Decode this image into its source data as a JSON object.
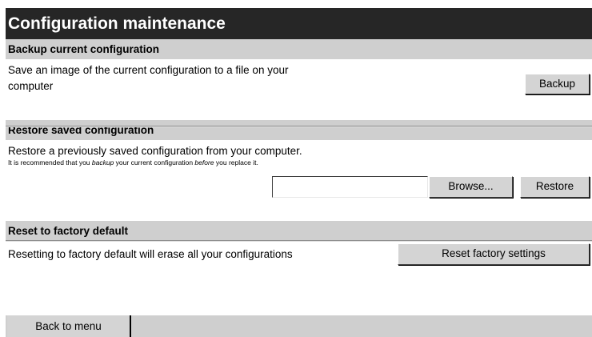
{
  "page_title": "Configuration maintenance",
  "backup": {
    "header": "Backup current configuration",
    "description_line1": "Save an image of the current configuration to a file on your",
    "description_line2": "computer",
    "button_label": "Backup"
  },
  "restore": {
    "header": "Restore saved configuration",
    "description": "Restore a previously saved configuration from your computer.",
    "note_part1": "It is recommended that you ",
    "note_em1": "backup",
    "note_part2": " your current configuration ",
    "note_em2": "before",
    "note_part3": " you replace it.",
    "file_value": "",
    "browse_label": "Browse...",
    "restore_label": "Restore"
  },
  "reset": {
    "header": "Reset to factory default",
    "description": "Resetting to factory default will erase all your configurations",
    "button_label": "Reset factory settings"
  },
  "footer": {
    "back_label": "Back to menu"
  }
}
